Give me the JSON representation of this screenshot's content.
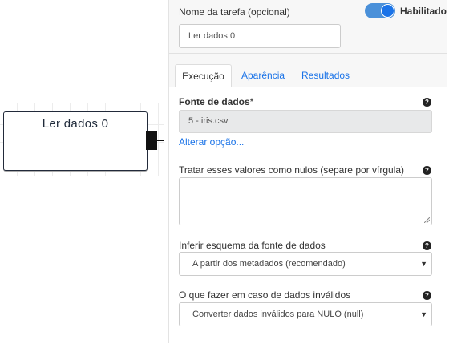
{
  "canvas": {
    "node": {
      "title": "Ler dados 0"
    }
  },
  "panel": {
    "task_name": {
      "label": "Nome da tarefa (opcional)",
      "value": "Ler dados 0"
    },
    "enabled_toggle": {
      "label": "Habilitado",
      "on": true
    },
    "tabs": [
      {
        "label": "Execução",
        "active": true
      },
      {
        "label": "Aparência",
        "active": false
      },
      {
        "label": "Resultados",
        "active": false
      }
    ],
    "data_source": {
      "label": "Fonte de dados",
      "required_mark": "*",
      "value": "5 - iris.csv",
      "change_link": "Alterar opção..."
    },
    "nulls": {
      "label": "Tratar esses valores como nulos (separe por vírgula)",
      "value": ""
    },
    "schema": {
      "label": "Inferir esquema da fonte de dados",
      "selected": "A partir dos metadados (recomendado)"
    },
    "invalid": {
      "label": "O que fazer em caso de dados inválidos",
      "selected": "Converter dados inválidos para NULO (null)"
    },
    "help_glyph": "?",
    "caret_glyph": "▼"
  },
  "colors": {
    "accent": "#1a73e8",
    "toggle_track": "#4a90d9",
    "node_border": "#222a3a",
    "readonly_bg": "#e8e9ea"
  }
}
